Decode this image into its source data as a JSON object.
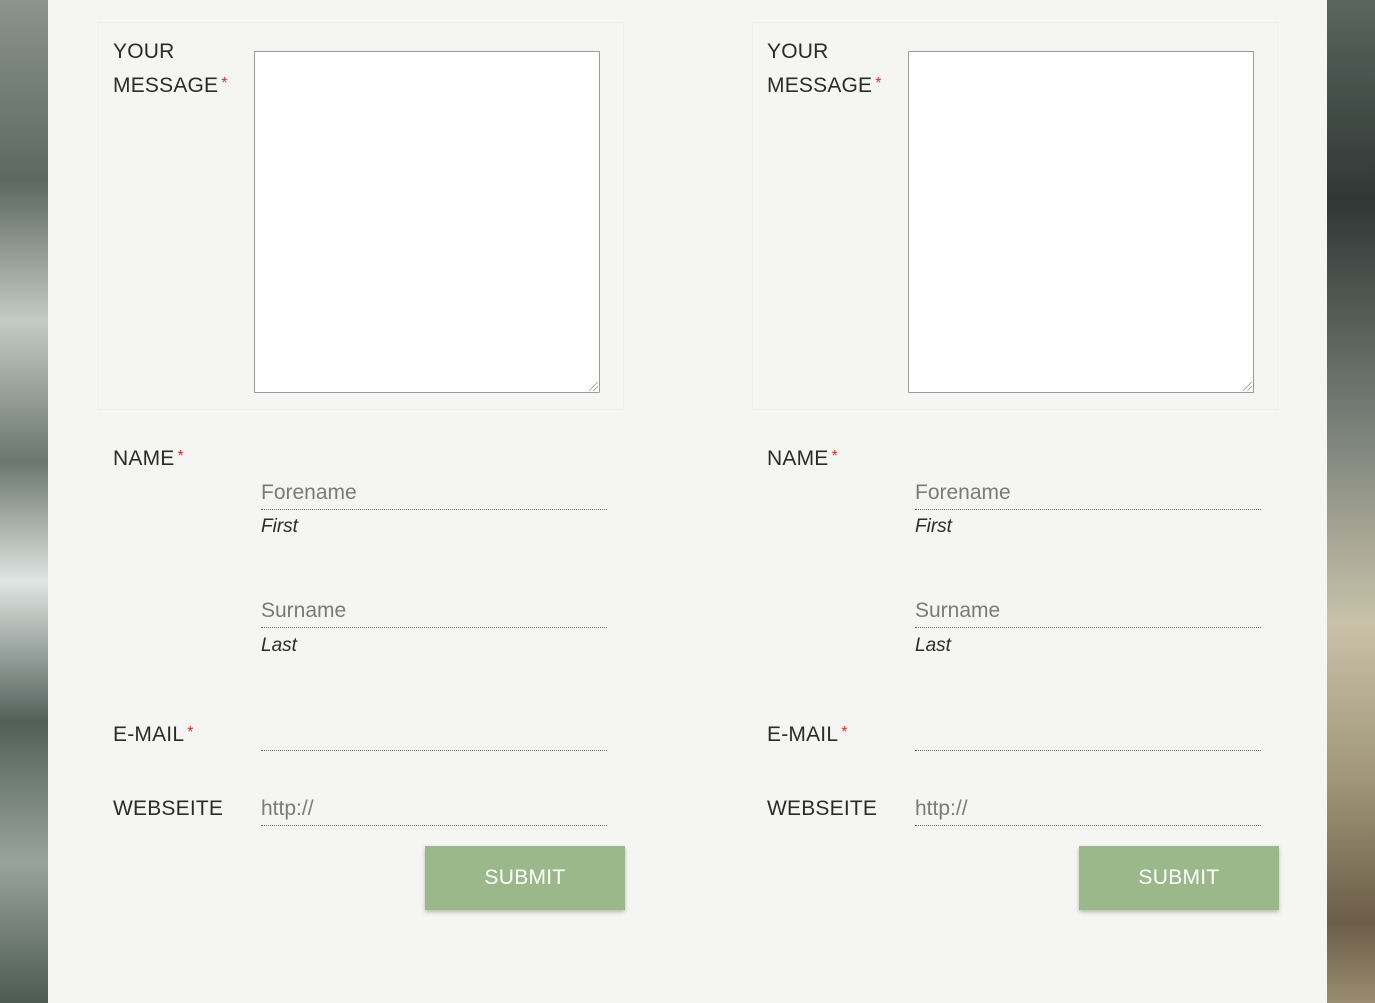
{
  "forms": [
    {
      "message_label_line1": "YOUR",
      "message_label_line2": "MESSAGE",
      "required_mark": "*",
      "name_label": "NAME",
      "forename_placeholder": "Forename",
      "first_sublabel": "First",
      "surname_placeholder": "Surname",
      "last_sublabel": "Last",
      "email_label": "E-MAIL",
      "email_value": "",
      "website_label": "WEBSEITE",
      "website_value": "http://",
      "submit_label": "SUBMIT"
    },
    {
      "message_label_line1": "YOUR",
      "message_label_line2": "MESSAGE",
      "required_mark": "*",
      "name_label": "NAME",
      "forename_placeholder": "Forename",
      "first_sublabel": "First",
      "surname_placeholder": "Surname",
      "last_sublabel": "Last",
      "email_label": "E-MAIL",
      "email_value": "",
      "website_label": "WEBSEITE",
      "website_value": "http://",
      "submit_label": "SUBMIT"
    }
  ],
  "colors": {
    "submit_bg": "#9bb88a",
    "required": "#d9302a",
    "panel_bg": "#fafaf8"
  }
}
